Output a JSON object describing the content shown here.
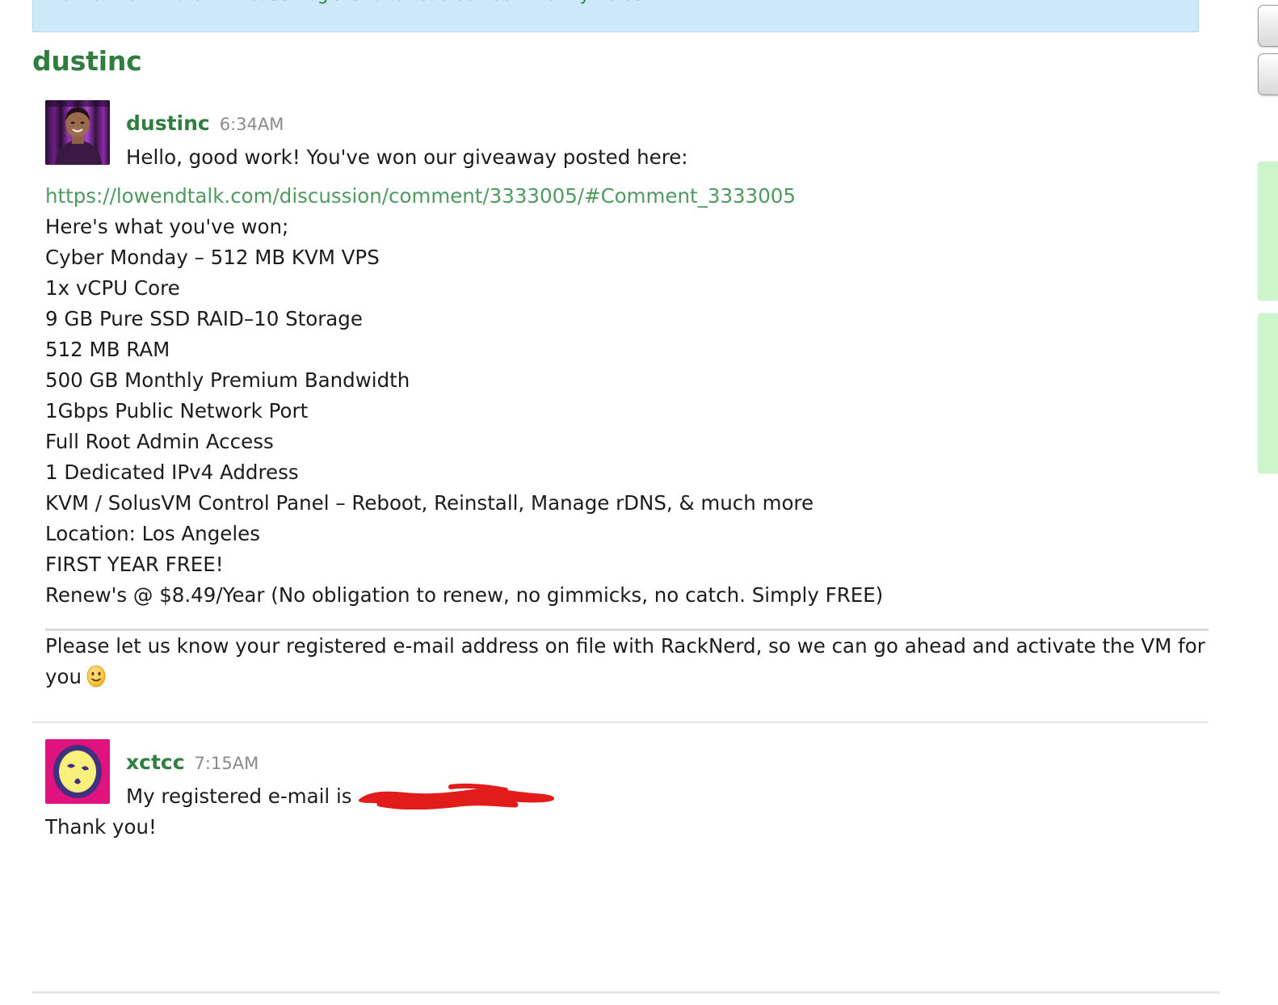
{
  "banner": {
    "text": "New on LowEndTalk? Please Register and read our Community Rules.",
    "background_color": "#cde8f8",
    "link_color": "#2f7d3f"
  },
  "page": {
    "title": "dustinc",
    "accent_color": "#2f7d3f",
    "link_color": "#4f9a5f",
    "background_color": "#ffffff"
  },
  "comments": [
    {
      "author": "dustinc",
      "time": "6:34AM",
      "avatar_name": "avatar-dustinc-photo",
      "greeting": "Hello, good work! You've won our giveaway posted here:",
      "link_text": "https://lowendtalk.com/discussion/comment/3333005/#Comment_3333005",
      "intro": "Here's what you've won;",
      "offer_title": "Cyber Monday – 512 MB KVM VPS",
      "specs": [
        "1x vCPU Core",
        "9 GB Pure SSD RAID–10 Storage",
        "512 MB RAM",
        "500 GB Monthly Premium Bandwidth",
        "1Gbps Public Network Port",
        "Full Root Admin Access",
        "1 Dedicated IPv4 Address",
        "KVM / SolusVM Control Panel – Reboot, Reinstall, Manage rDNS, & much more",
        "Location: Los Angeles",
        "FIRST YEAR FREE!",
        "Renew's @ $8.49/Year (No obligation to renew, no gimmicks, no catch. Simply FREE)"
      ],
      "closing": "Please let us know your registered e-mail address on file with RackNerd, so we can go ahead and activate the VM for you",
      "closing_emoji_name": "slightly-smiling-face-emoji"
    },
    {
      "author": "xctcc",
      "time": "7:15AM",
      "avatar_name": "avatar-xctcc-identicon",
      "line_1_prefix": "My registered e-mail is",
      "line_1_redacted": true,
      "redaction_color": "#e21b1b",
      "line_2": "Thank you!"
    }
  ],
  "sidebar_widgets": {
    "buttons": [
      "side-button-top",
      "side-button-second"
    ],
    "panels": [
      "side-panel-upper",
      "side-panel-lower"
    ],
    "panel_color": "#ccf5cc"
  }
}
